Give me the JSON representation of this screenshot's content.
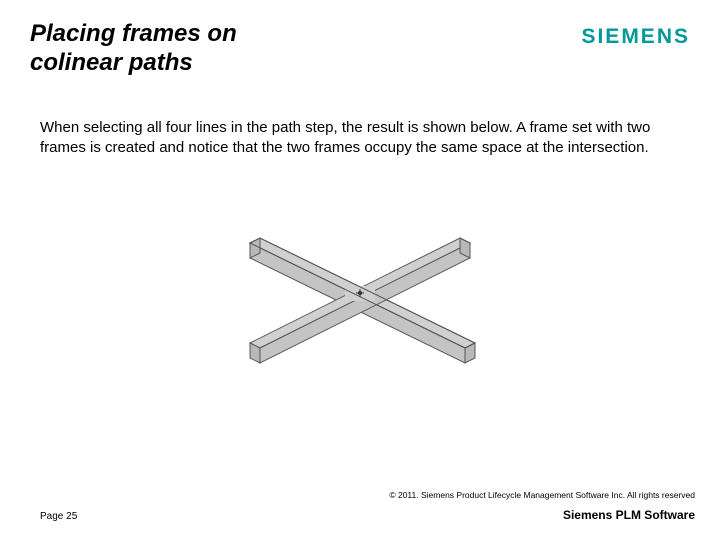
{
  "header": {
    "title": "Placing frames on colinear paths",
    "logo": "SIEMENS"
  },
  "body": {
    "paragraph": "When selecting all four lines in the path step, the result is shown below. A frame set with two frames is created and notice that the two frames occupy the same space at the intersection."
  },
  "footer": {
    "copyright": "© 2011. Siemens Product Lifecycle Management Software Inc. All rights reserved",
    "page": "Page 25",
    "brand": "Siemens PLM Software"
  }
}
